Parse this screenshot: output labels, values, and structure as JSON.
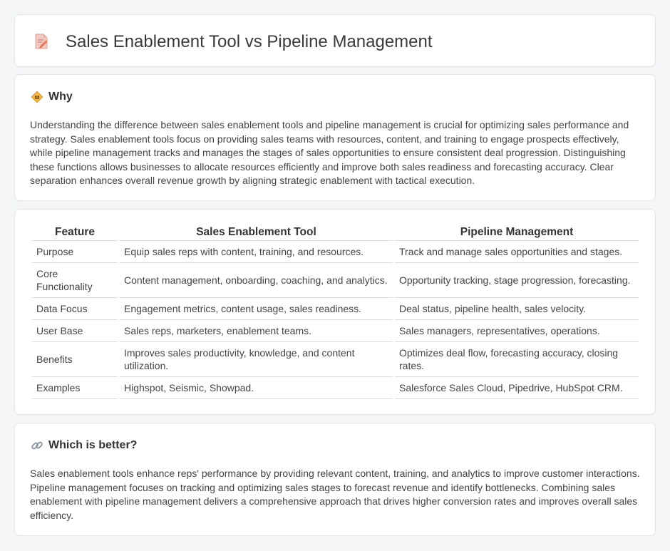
{
  "header": {
    "title": "Sales Enablement Tool vs Pipeline Management",
    "icon": "document-pencil-icon"
  },
  "why": {
    "title": "Why",
    "icon": "diamond-sign-icon",
    "text": "Understanding the difference between sales enablement tools and pipeline management is crucial for optimizing sales performance and strategy. Sales enablement tools focus on providing sales teams with resources, content, and training to engage prospects effectively, while pipeline management tracks and manages the stages of sales opportunities to ensure consistent deal progression. Distinguishing these functions allows businesses to allocate resources efficiently and improve both sales readiness and forecasting accuracy. Clear separation enhances overall revenue growth by aligning strategic enablement with tactical execution."
  },
  "table": {
    "headers": [
      "Feature",
      "Sales Enablement Tool",
      "Pipeline Management"
    ],
    "rows": [
      [
        "Purpose",
        "Equip sales reps with content, training, and resources.",
        "Track and manage sales opportunities and stages."
      ],
      [
        "Core Functionality",
        "Content management, onboarding, coaching, and analytics.",
        "Opportunity tracking, stage progression, forecasting."
      ],
      [
        "Data Focus",
        "Engagement metrics, content usage, sales readiness.",
        "Deal status, pipeline health, sales velocity."
      ],
      [
        "User Base",
        "Sales reps, marketers, enablement teams.",
        "Sales managers, representatives, operations."
      ],
      [
        "Benefits",
        "Improves sales productivity, knowledge, and content utilization.",
        "Optimizes deal flow, forecasting accuracy, closing rates."
      ],
      [
        "Examples",
        "Highspot, Seismic, Showpad.",
        "Salesforce Sales Cloud, Pipedrive, HubSpot CRM."
      ]
    ]
  },
  "better": {
    "title": "Which is better?",
    "icon": "link-icon",
    "text": "Sales enablement tools enhance reps' performance by providing relevant content, training, and analytics to improve customer interactions. Pipeline management focuses on tracking and optimizing sales stages to forecast revenue and identify bottlenecks. Combining sales enablement with pipeline management delivers a comprehensive approach that drives higher conversion rates and improves overall sales efficiency."
  }
}
